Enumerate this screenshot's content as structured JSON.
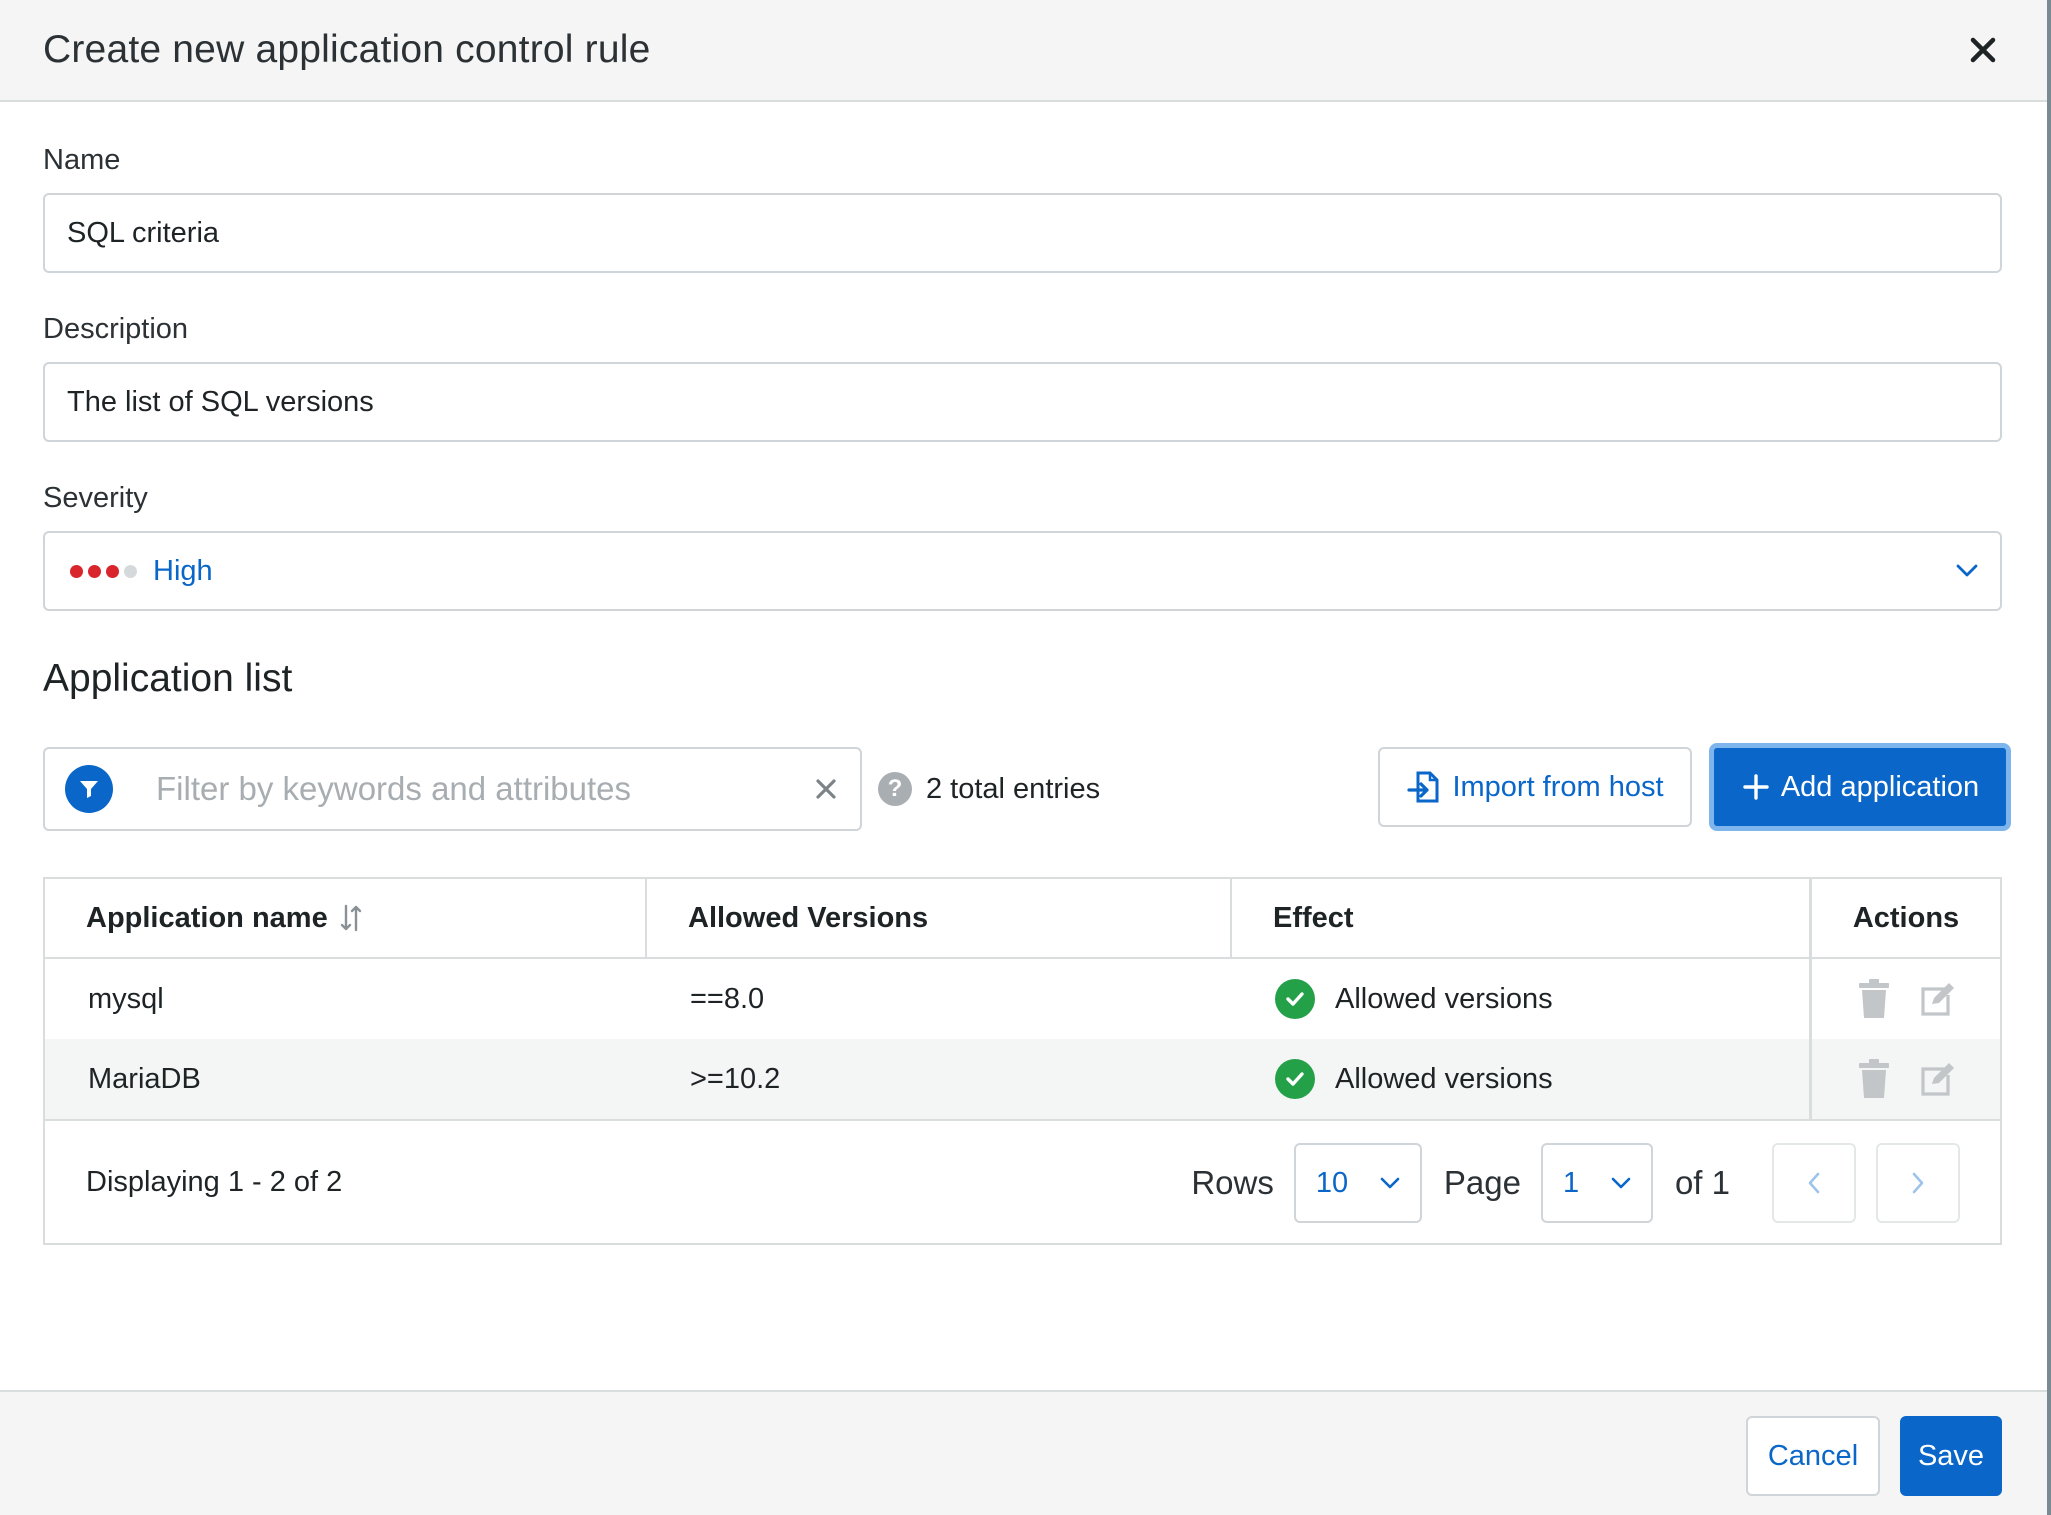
{
  "dialog": {
    "title": "Create new application control rule"
  },
  "form": {
    "name_label": "Name",
    "name_value": "SQL criteria",
    "description_label": "Description",
    "description_value": "The list of SQL versions",
    "severity_label": "Severity",
    "severity_value": "High",
    "severity_level": 3,
    "severity_max": 4
  },
  "application_list": {
    "title": "Application list",
    "filter_placeholder": "Filter by keywords and attributes",
    "total_entries": "2 total entries",
    "import_label": "Import from host",
    "add_label": "Add application",
    "columns": [
      "Application name",
      "Allowed Versions",
      "Effect",
      "Actions"
    ],
    "rows": [
      {
        "name": "mysql",
        "versions": "==8.0",
        "effect": "Allowed versions"
      },
      {
        "name": "MariaDB",
        "versions": ">=10.2",
        "effect": "Allowed versions"
      }
    ],
    "pagination": {
      "displaying": "Displaying 1 - 2 of 2",
      "rows_label": "Rows",
      "rows_value": "10",
      "page_label": "Page",
      "page_value": "1",
      "of_label": "of 1"
    }
  },
  "footer": {
    "cancel_label": "Cancel",
    "save_label": "Save"
  },
  "colors": {
    "primary": "#0a66c8",
    "severity_high": "#d8262c",
    "success": "#24a148"
  },
  "icons": [
    "close-icon",
    "chevron-down-icon",
    "filter-icon",
    "clear-icon",
    "help-icon",
    "import-icon",
    "plus-icon",
    "sort-icon",
    "check-circle-icon",
    "trash-icon",
    "edit-icon",
    "chevron-left-icon",
    "chevron-right-icon"
  ]
}
